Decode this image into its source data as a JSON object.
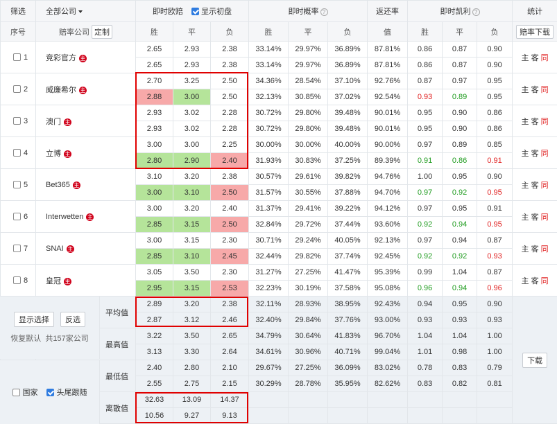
{
  "header": {
    "filter": "筛选",
    "company_select": "全部公司",
    "live_odds": "即时欧赔",
    "show_initial": "显示初盘",
    "live_prob": "即时概率",
    "return_rate": "返还率",
    "live_kelly": "即时凯利",
    "stats": "统计"
  },
  "subheader": {
    "seq": "序号",
    "company": "赔率公司",
    "custom": "定制",
    "win": "胜",
    "draw": "平",
    "lose": "负",
    "value": "值",
    "download": "赔率下载"
  },
  "badge_char": "主",
  "stat_labels": {
    "home": "主",
    "away": "客",
    "same": "同"
  },
  "companies": [
    {
      "seq": "1",
      "name": "竞彩官方",
      "rows": [
        {
          "odds": [
            "2.65",
            "2.93",
            "2.38"
          ],
          "prob": [
            "33.14%",
            "29.97%",
            "36.89%"
          ],
          "ret": "87.81%",
          "kelly": [
            "0.86",
            "0.87",
            "0.90"
          ]
        },
        {
          "odds": [
            "2.65",
            "2.93",
            "2.38"
          ],
          "prob": [
            "33.14%",
            "29.97%",
            "36.89%"
          ],
          "ret": "87.81%",
          "kelly": [
            "0.86",
            "0.87",
            "0.90"
          ]
        }
      ]
    },
    {
      "seq": "2",
      "name": "威廉希尔",
      "rows": [
        {
          "odds": [
            "2.70",
            "3.25",
            "2.50"
          ],
          "prob": [
            "34.36%",
            "28.54%",
            "37.10%"
          ],
          "ret": "92.76%",
          "kelly": [
            "0.87",
            "0.97",
            "0.95"
          ]
        },
        {
          "odds": [
            "2.88",
            "3.00",
            "2.50"
          ],
          "prob": [
            "32.13%",
            "30.85%",
            "37.02%"
          ],
          "ret": "92.54%",
          "kelly": [
            "0.93",
            "0.89",
            "0.95"
          ]
        }
      ]
    },
    {
      "seq": "3",
      "name": "澳门",
      "rows": [
        {
          "odds": [
            "2.93",
            "3.02",
            "2.28"
          ],
          "prob": [
            "30.72%",
            "29.80%",
            "39.48%"
          ],
          "ret": "90.01%",
          "kelly": [
            "0.95",
            "0.90",
            "0.86"
          ]
        },
        {
          "odds": [
            "2.93",
            "3.02",
            "2.28"
          ],
          "prob": [
            "30.72%",
            "29.80%",
            "39.48%"
          ],
          "ret": "90.01%",
          "kelly": [
            "0.95",
            "0.90",
            "0.86"
          ]
        }
      ]
    },
    {
      "seq": "4",
      "name": "立博",
      "rows": [
        {
          "odds": [
            "3.00",
            "3.00",
            "2.25"
          ],
          "prob": [
            "30.00%",
            "30.00%",
            "40.00%"
          ],
          "ret": "90.00%",
          "kelly": [
            "0.97",
            "0.89",
            "0.85"
          ]
        },
        {
          "odds": [
            "2.80",
            "2.90",
            "2.40"
          ],
          "prob": [
            "31.93%",
            "30.83%",
            "37.25%"
          ],
          "ret": "89.39%",
          "kelly": [
            "0.91",
            "0.86",
            "0.91"
          ]
        }
      ]
    },
    {
      "seq": "5",
      "name": "Bet365",
      "rows": [
        {
          "odds": [
            "3.10",
            "3.20",
            "2.38"
          ],
          "prob": [
            "30.57%",
            "29.61%",
            "39.82%"
          ],
          "ret": "94.76%",
          "kelly": [
            "1.00",
            "0.95",
            "0.90"
          ]
        },
        {
          "odds": [
            "3.00",
            "3.10",
            "2.50"
          ],
          "prob": [
            "31.57%",
            "30.55%",
            "37.88%"
          ],
          "ret": "94.70%",
          "kelly": [
            "0.97",
            "0.92",
            "0.95"
          ]
        }
      ]
    },
    {
      "seq": "6",
      "name": "Interwetten",
      "rows": [
        {
          "odds": [
            "3.00",
            "3.20",
            "2.40"
          ],
          "prob": [
            "31.37%",
            "29.41%",
            "39.22%"
          ],
          "ret": "94.12%",
          "kelly": [
            "0.97",
            "0.95",
            "0.91"
          ]
        },
        {
          "odds": [
            "2.85",
            "3.15",
            "2.50"
          ],
          "prob": [
            "32.84%",
            "29.72%",
            "37.44%"
          ],
          "ret": "93.60%",
          "kelly": [
            "0.92",
            "0.94",
            "0.95"
          ]
        }
      ]
    },
    {
      "seq": "7",
      "name": "SNAI",
      "rows": [
        {
          "odds": [
            "3.00",
            "3.15",
            "2.30"
          ],
          "prob": [
            "30.71%",
            "29.24%",
            "40.05%"
          ],
          "ret": "92.13%",
          "kelly": [
            "0.97",
            "0.94",
            "0.87"
          ]
        },
        {
          "odds": [
            "2.85",
            "3.10",
            "2.45"
          ],
          "prob": [
            "32.44%",
            "29.82%",
            "37.74%"
          ],
          "ret": "92.45%",
          "kelly": [
            "0.92",
            "0.92",
            "0.93"
          ]
        }
      ]
    },
    {
      "seq": "8",
      "name": "皇冠",
      "rows": [
        {
          "odds": [
            "3.05",
            "3.50",
            "2.30"
          ],
          "prob": [
            "31.27%",
            "27.25%",
            "41.47%"
          ],
          "ret": "95.39%",
          "kelly": [
            "0.99",
            "1.04",
            "0.87"
          ]
        },
        {
          "odds": [
            "2.95",
            "3.15",
            "2.53"
          ],
          "prob": [
            "32.23%",
            "30.19%",
            "37.58%"
          ],
          "ret": "95.08%",
          "kelly": [
            "0.96",
            "0.94",
            "0.96"
          ]
        }
      ]
    }
  ],
  "controls": {
    "select_shown": "显示选择",
    "invert": "反选",
    "restore": "恢复默认",
    "total": "共157家公司",
    "country": "国家",
    "head_tail": "头尾跟随",
    "download": "下载"
  },
  "summary": {
    "avg": {
      "label": "平均值",
      "rows": [
        {
          "odds": [
            "2.89",
            "3.20",
            "2.38"
          ],
          "prob": [
            "32.11%",
            "28.93%",
            "38.95%"
          ],
          "ret": "92.43%",
          "kelly": [
            "0.94",
            "0.95",
            "0.90"
          ]
        },
        {
          "odds": [
            "2.87",
            "3.12",
            "2.46"
          ],
          "prob": [
            "32.40%",
            "29.84%",
            "37.76%"
          ],
          "ret": "93.00%",
          "kelly": [
            "0.93",
            "0.93",
            "0.93"
          ]
        }
      ]
    },
    "max": {
      "label": "最高值",
      "rows": [
        {
          "odds": [
            "3.22",
            "3.50",
            "2.65"
          ],
          "prob": [
            "34.79%",
            "30.64%",
            "41.83%"
          ],
          "ret": "96.70%",
          "kelly": [
            "1.04",
            "1.04",
            "1.00"
          ]
        },
        {
          "odds": [
            "3.13",
            "3.30",
            "2.64"
          ],
          "prob": [
            "34.61%",
            "30.96%",
            "40.71%"
          ],
          "ret": "99.04%",
          "kelly": [
            "1.01",
            "0.98",
            "1.00"
          ]
        }
      ]
    },
    "min": {
      "label": "最低值",
      "rows": [
        {
          "odds": [
            "2.40",
            "2.80",
            "2.10"
          ],
          "prob": [
            "29.67%",
            "27.25%",
            "36.09%"
          ],
          "ret": "83.02%",
          "kelly": [
            "0.78",
            "0.83",
            "0.79"
          ]
        },
        {
          "odds": [
            "2.55",
            "2.75",
            "2.15"
          ],
          "prob": [
            "30.29%",
            "28.78%",
            "35.95%"
          ],
          "ret": "82.62%",
          "kelly": [
            "0.83",
            "0.82",
            "0.81"
          ]
        }
      ]
    },
    "disc": {
      "label": "离散值",
      "rows": [
        {
          "odds": [
            "32.63",
            "13.09",
            "14.37"
          ]
        },
        {
          "odds": [
            "10.56",
            "9.27",
            "9.13"
          ]
        }
      ]
    }
  },
  "colors": {
    "highlight": "#e00000",
    "green_cell": "#b5e49a",
    "red_cell": "#f7a9a9",
    "green_text": "#1e9b1e",
    "red_text": "#e02020"
  }
}
